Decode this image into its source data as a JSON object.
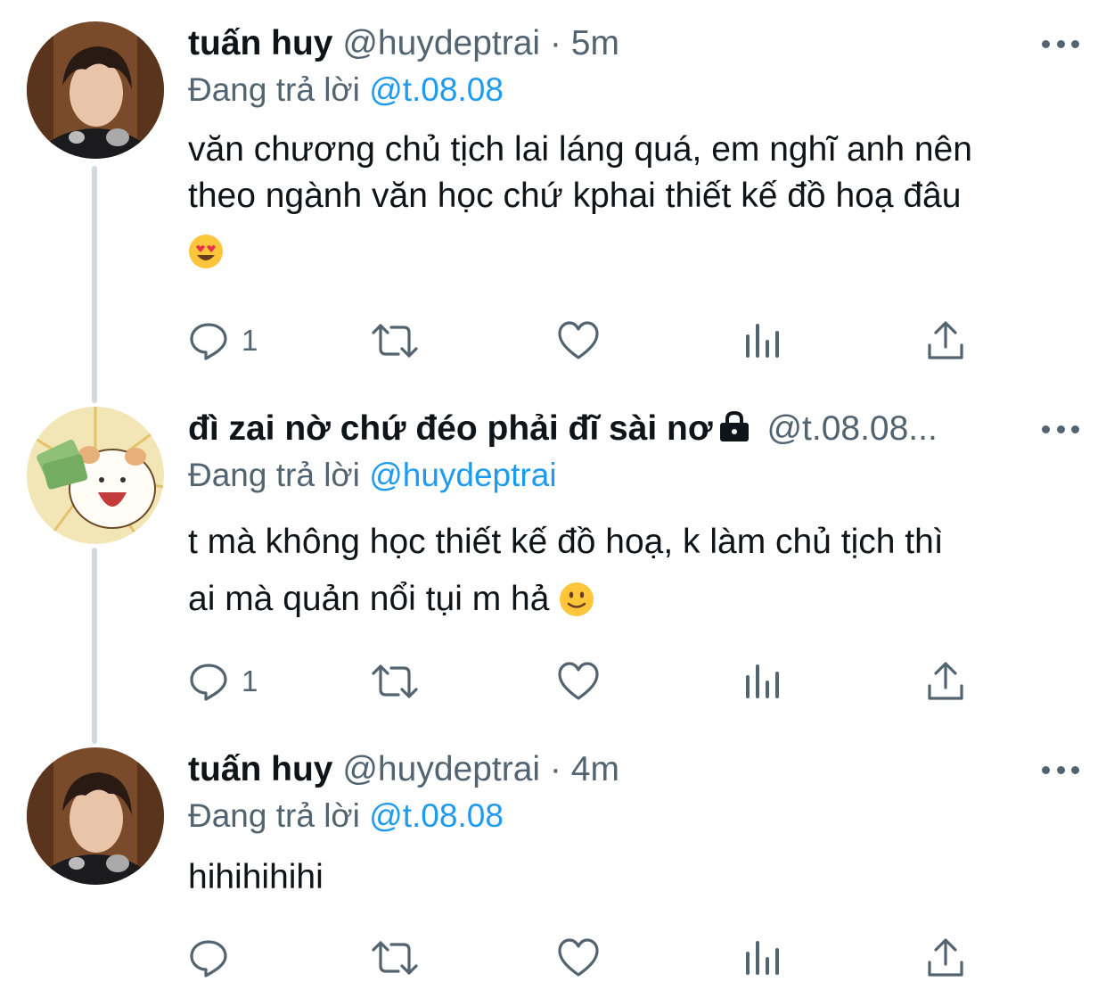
{
  "tweets": [
    {
      "name": "tuấn huy",
      "handle": "@huydeptrai",
      "separator": "·",
      "time": "5m",
      "reply_prefix": "Đang trả lời",
      "reply_to": "@t.08.08",
      "text_line1": "văn chương chủ tịch lai láng quá, em nghĩ anh nên",
      "text_line2": "theo ngành văn học chứ kphai thiết kế đồ hoạ đâu",
      "emoji": "heart-eyes",
      "reply_count": "1"
    },
    {
      "name": "đì zai nờ chứ đéo phải đĩ sài nơ",
      "locked": true,
      "handle": "@t.08.08...",
      "reply_prefix": "Đang trả lời",
      "reply_to": "@huydeptrai",
      "text_line1": "t mà không học thiết kế đồ hoạ, k làm chủ tịch thì",
      "text_line2": "ai mà quản nổi tụi m hả",
      "emoji": "slight-smile",
      "reply_count": "1"
    },
    {
      "name": "tuấn huy",
      "handle": "@huydeptrai",
      "separator": "·",
      "time": "4m",
      "reply_prefix": "Đang trả lời",
      "reply_to": "@t.08.08",
      "text_line1": "hihihihihi",
      "reply_count": ""
    }
  ],
  "icons": {
    "reply": "reply-icon",
    "retweet": "retweet-icon",
    "like": "heart-icon",
    "analytics": "analytics-icon",
    "share": "share-icon",
    "more": "more-icon",
    "lock": "lock-icon"
  },
  "colors": {
    "text": "#0f1419",
    "secondary": "#536471",
    "link": "#1d9bf0",
    "thread_line": "#cfd9de"
  }
}
